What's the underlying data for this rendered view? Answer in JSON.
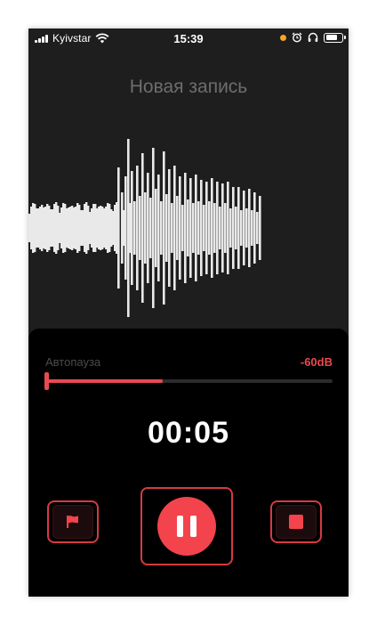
{
  "status_bar": {
    "carrier": "Kyivstar",
    "time": "15:39"
  },
  "recording": {
    "title": "Новая запись",
    "elapsed": "00:05"
  },
  "autopause": {
    "label": "Автопауза",
    "threshold": "-60dB",
    "level_fraction": 0.41
  },
  "controls": {
    "flag_icon": "flag-icon",
    "pause_icon": "pause-icon",
    "stop_icon": "stop-icon"
  },
  "colors": {
    "accent": "#f3434c",
    "highlight_frame": "#d63a41",
    "waveform": "#e9e9ea"
  }
}
